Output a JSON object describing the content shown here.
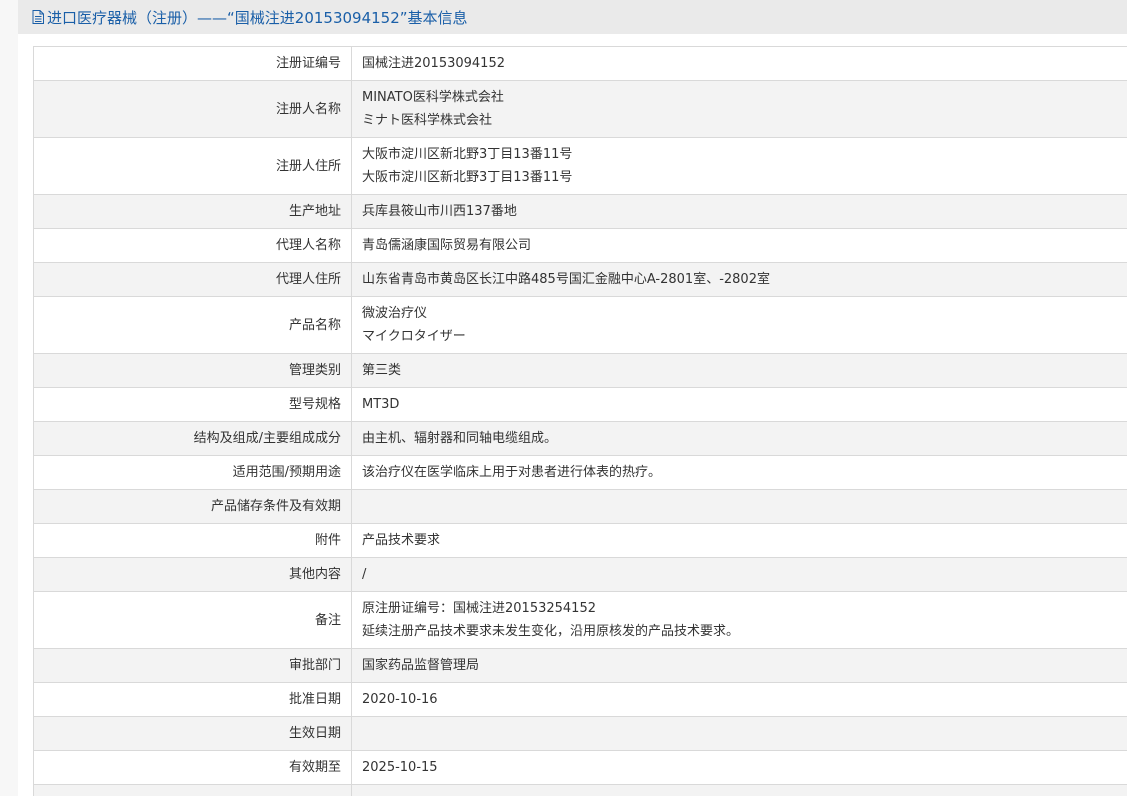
{
  "header": {
    "icon": "document-icon",
    "title": "进口医疗器械（注册）——“国械注进20153094152”基本信息"
  },
  "rows": [
    {
      "label": "注册证编号",
      "values": [
        "国械注进20153094152"
      ]
    },
    {
      "label": "注册人名称",
      "values": [
        "MINATO医科学株式会社",
        "ミナト医科学株式会社"
      ]
    },
    {
      "label": "注册人住所",
      "values": [
        "大阪市淀川区新北野3丁目13番11号",
        "大阪市淀川区新北野3丁目13番11号"
      ]
    },
    {
      "label": "生产地址",
      "values": [
        "兵库县筱山市川西137番地"
      ]
    },
    {
      "label": "代理人名称",
      "values": [
        "青岛儒涵康国际贸易有限公司"
      ]
    },
    {
      "label": "代理人住所",
      "values": [
        "山东省青岛市黄岛区长江中路485号国汇金融中心A-2801室、-2802室"
      ]
    },
    {
      "label": "产品名称",
      "values": [
        "微波治疗仪",
        "マイクロタイザー"
      ]
    },
    {
      "label": "管理类别",
      "values": [
        "第三类"
      ]
    },
    {
      "label": "型号规格",
      "values": [
        "MT3D"
      ]
    },
    {
      "label": "结构及组成/主要组成成分",
      "values": [
        "由主机、辐射器和同轴电缆组成。"
      ]
    },
    {
      "label": "适用范围/预期用途",
      "values": [
        "该治疗仪在医学临床上用于对患者进行体表的热疗。"
      ]
    },
    {
      "label": "产品储存条件及有效期",
      "values": [
        ""
      ]
    },
    {
      "label": "附件",
      "values": [
        "产品技术要求"
      ]
    },
    {
      "label": "其他内容",
      "values": [
        "/"
      ]
    },
    {
      "label": "备注",
      "values": [
        "原注册证编号：国械注进20153254152",
        "延续注册产品技术要求未发生变化，沿用原核发的产品技术要求。"
      ]
    },
    {
      "label": "审批部门",
      "values": [
        "国家药品监督管理局"
      ]
    },
    {
      "label": "批准日期",
      "values": [
        "2020-10-16"
      ]
    },
    {
      "label": "生效日期",
      "values": [
        ""
      ]
    },
    {
      "label": "有效期至",
      "values": [
        "2025-10-15"
      ]
    },
    {
      "label": "",
      "values": [
        ""
      ]
    }
  ]
}
